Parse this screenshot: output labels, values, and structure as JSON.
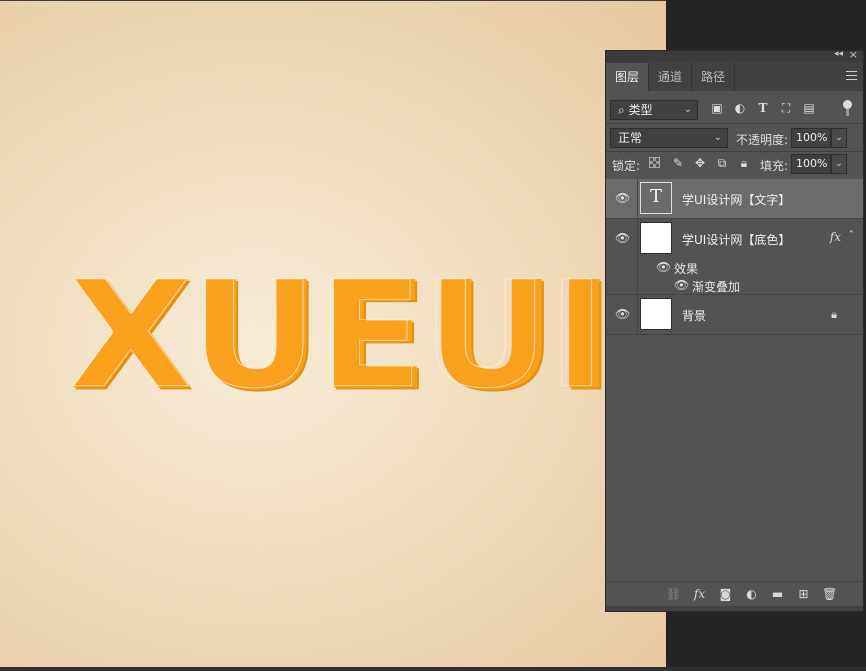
{
  "canvas": {
    "art_text": "XUEUI"
  },
  "panel": {
    "tabs": [
      {
        "label": "图层",
        "active": true
      },
      {
        "label": "通道",
        "active": false
      },
      {
        "label": "路径",
        "active": false
      }
    ],
    "filter": {
      "kind_label": "类型"
    },
    "blend": {
      "mode": "正常",
      "opacity_label": "不透明度:",
      "opacity_value": "100%"
    },
    "lock": {
      "label": "锁定:",
      "fill_label": "填充:",
      "fill_value": "100%"
    },
    "layers": [
      {
        "name": "学UI设计网【文字】",
        "type": "text",
        "selected": true
      },
      {
        "name": "学UI设计网【底色】",
        "type": "fill",
        "fx": "fx",
        "effects_label": "效果",
        "effects": [
          "渐变叠加"
        ]
      },
      {
        "name": "背景",
        "type": "background",
        "locked": true
      }
    ]
  },
  "colors": {
    "text_orange": "#f9a11c",
    "panel_bg": "#535353"
  },
  "icons": [
    "search-icon",
    "image-filter-icon",
    "adjustment-filter-icon",
    "type-filter-icon",
    "shape-filter-icon",
    "smart-object-filter-icon",
    "eye-icon",
    "lock-icon",
    "link-icon",
    "fx-icon",
    "mask-icon",
    "new-adjustment-icon",
    "folder-icon",
    "new-layer-icon",
    "trash-icon"
  ]
}
